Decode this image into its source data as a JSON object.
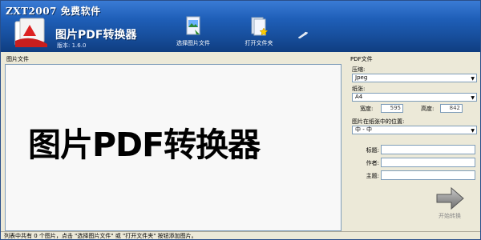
{
  "header": {
    "app_name": "ZXT2007 免费软件",
    "product_title": "图片PDF转换器",
    "version": "版本: 1.6.0"
  },
  "toolbar": {
    "select_images_label": "选择图片文件",
    "open_folder_label": "打开文件夹"
  },
  "left_panel": {
    "heading": "图片文件",
    "watermark_text": "图片PDF转换器"
  },
  "right_panel": {
    "heading": "PDF文件",
    "compression_label": "压缩:",
    "compression_value": "Jpeg",
    "paper_label": "纸张:",
    "paper_value": "A4",
    "width_label": "宽度:",
    "width_value": "595",
    "height_label": "高度:",
    "height_value": "842",
    "position_label": "图片在纸张中的位置:",
    "position_value": "中 - 中",
    "title_label": "标题:",
    "author_label": "作者:",
    "subject_label": "主题:",
    "start_label": "开始转换"
  },
  "status": {
    "text": "列表中共有 0 个图片，点击 \"选择图片文件\" 或 \"打开文件夹\" 按钮添加图片。"
  },
  "colors": {
    "header_blue": "#1f5fb8",
    "panel_bg": "#ece9d8",
    "input_border": "#7f9db9"
  },
  "icons": {
    "logo": "pdf-document-icon",
    "select_images": "image-file-icon",
    "open_folder": "folder-star-icon",
    "settings": "wrench-icon",
    "start": "arrow-right-icon"
  }
}
